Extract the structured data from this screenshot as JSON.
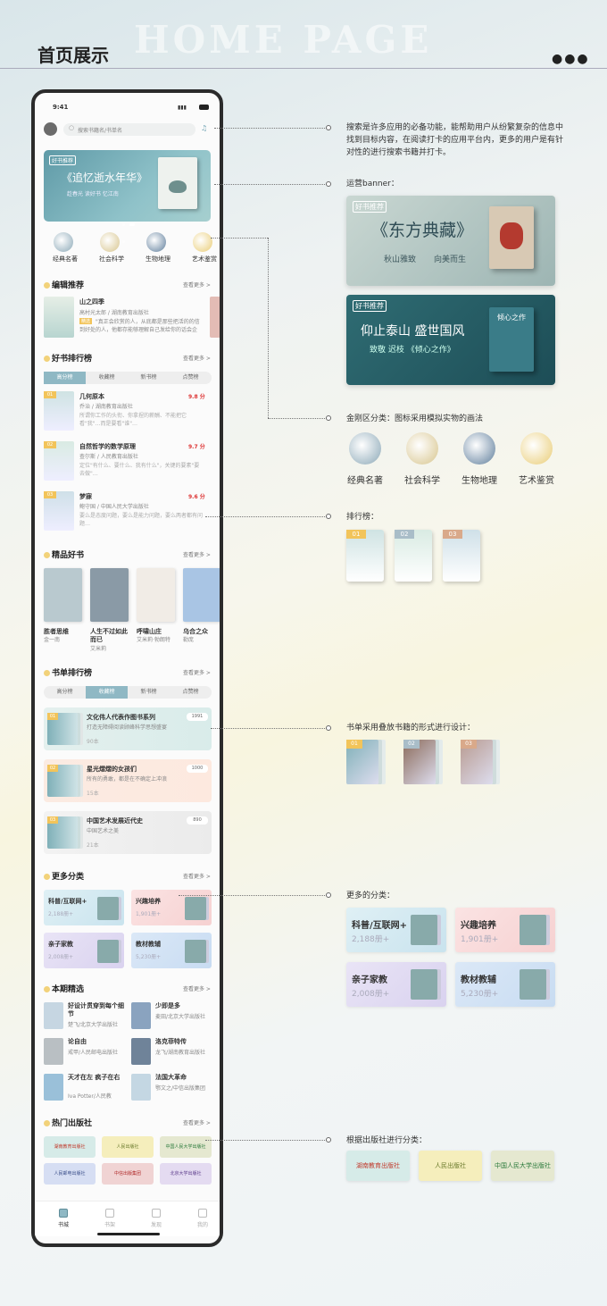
{
  "header": {
    "bg_title": "HOME PAGE",
    "title": "首页展示"
  },
  "phone": {
    "time": "9:41",
    "search_placeholder": "搜索书籍名/书单名",
    "banner": {
      "badge": "好书推荐",
      "title": "《追忆逝水年华》",
      "subtitle": "趁春光 读好书 忆江南"
    },
    "categories": [
      "经典名著",
      "社会科学",
      "生物地理",
      "艺术鉴赏"
    ],
    "editor": {
      "title": "编辑推荐",
      "more": "查看更多 >",
      "book": "山之四季",
      "author": "高村光太郎 / 湖南教育出版社",
      "tag": "精选",
      "desc": "\"真正会欣赏的人，从底都是那些把活的的信到好处的人，他都存能够理解自己发给你的话会企会…"
    },
    "rank": {
      "title": "好书排行榜",
      "more": "查看更多 >",
      "tabs": [
        "高分榜",
        "收藏榜",
        "新书榜",
        "点赞榜"
      ],
      "items": [
        {
          "no": "01",
          "name": "几何原本",
          "meta": "乔治 / 湖南教育出版社",
          "score": "9.8 分",
          "desc": "所谓你工作的头衔、你拿捏的薪酬、不能把它看\"我\"…而是要看\"谁\"…"
        },
        {
          "no": "02",
          "name": "自然哲学的数学原理",
          "meta": "查尔斯 / 人民教育出版社",
          "score": "9.7 分",
          "desc": "定位\"有什么、要什么、我有什么\"，关键的要素\"要去做\"…"
        },
        {
          "no": "03",
          "name": "梦寐",
          "meta": "鲍守国 / 中国人民大学出版社",
          "score": "9.6 分",
          "desc": "要么是态度问题，要么是能力问题，要么两者都有问题…"
        }
      ]
    },
    "quality": {
      "title": "精品好书",
      "more": "查看更多 >",
      "books": [
        {
          "name": "胜者思维",
          "author": "金一南"
        },
        {
          "name": "人生不过如此而已",
          "author": "艾米莉"
        },
        {
          "name": "呼啸山庄",
          "author": "艾米莉·勃朗特"
        },
        {
          "name": "乌合之众",
          "author": "勒庞"
        }
      ]
    },
    "lists": {
      "title": "书单排行榜",
      "more": "查看更多 >",
      "tabs": [
        "高分榜",
        "收藏榜",
        "新书榜",
        "点赞榜"
      ],
      "items": [
        {
          "no": "01",
          "name": "文化伟人代表作图书系列",
          "count": "1991",
          "desc": "打造无障碍阅读顾峰科学思想盛宴",
          "books": "90本"
        },
        {
          "no": "02",
          "name": "星光熠熠的女孩们",
          "count": "1000",
          "desc": "所有的勇敢，都是在不确定上冲浪",
          "books": "15本"
        },
        {
          "no": "03",
          "name": "中国艺术发展近代史",
          "count": "890",
          "desc": "中国艺术之美",
          "books": "21本"
        }
      ]
    },
    "morecat": {
      "title": "更多分类",
      "more": "查看更多 >",
      "items": [
        {
          "name": "科普/互联网+",
          "count": "2,188册+"
        },
        {
          "name": "兴趣培养",
          "count": "1,901册+"
        },
        {
          "name": "亲子家教",
          "count": "2,008册+"
        },
        {
          "name": "教材教辅",
          "count": "5,230册+"
        }
      ]
    },
    "issue": {
      "title": "本期精选",
      "more": "查看更多 >",
      "items": [
        {
          "name": "好设计贯穿到每个细节",
          "meta": "楚飞/北京大学出版社"
        },
        {
          "name": "少即是多",
          "meta": "麦田/北京大学出版社"
        },
        {
          "name": "论自由",
          "meta": "戒甲/人民邮电出版社"
        },
        {
          "name": "洛克菲特传",
          "meta": "龙飞/湖南教育出版社"
        },
        {
          "name": "天才在左 疯子在右",
          "meta": "Iva Potter/人民教"
        },
        {
          "name": "法国大革命",
          "meta": "鄂文之/中信出版集团"
        }
      ]
    },
    "publisher": {
      "title": "热门出版社",
      "more": "查看更多 >",
      "items": [
        "湖南教育出版社",
        "人民出版社",
        "中国人民大学出版社",
        "人民邮电出版社",
        "中信出版集团",
        "北京大学出版社"
      ]
    },
    "nav": [
      "书城",
      "书架",
      "发现",
      "我的"
    ]
  },
  "annotations": {
    "search": "搜索是许多应用的必备功能，能帮助用户从纷繁复杂的信息中找到目标内容，在阅读打卡的应用平台内，更多的用户是有针对性的进行搜索书籍并打卡。",
    "banner": "运营banner：",
    "banner1": {
      "badge": "好书推荐",
      "title": "《东方典藏》",
      "left": "秋山雅致",
      "right": "向美而生"
    },
    "banner2": {
      "badge": "好书推荐",
      "title": "仰止泰山 盛世国风",
      "sub": "致敬 迟枝 《倾心之作》",
      "book": "倾心之作"
    },
    "category": "金刚区分类：图标采用模拟实物的画法",
    "categories": [
      "经典名著",
      "社会科学",
      "生物地理",
      "艺术鉴赏"
    ],
    "ranking": "排行榜：",
    "rank_nos": [
      "01",
      "02",
      "03"
    ],
    "lists": "书单采用叠放书籍的形式进行设计：",
    "list_nos": [
      "01",
      "02",
      "03"
    ],
    "morecat": "更多的分类：",
    "morecat_items": [
      {
        "name": "科普/互联网+",
        "count": "2,188册+"
      },
      {
        "name": "兴趣培养",
        "count": "1,901册+"
      },
      {
        "name": "亲子家教",
        "count": "2,008册+"
      },
      {
        "name": "教材教辅",
        "count": "5,230册+"
      }
    ],
    "publisher": "根据出版社进行分类：",
    "publishers": [
      "湖南教育出版社",
      "人民出版社",
      "中国人民大学出版社"
    ]
  }
}
